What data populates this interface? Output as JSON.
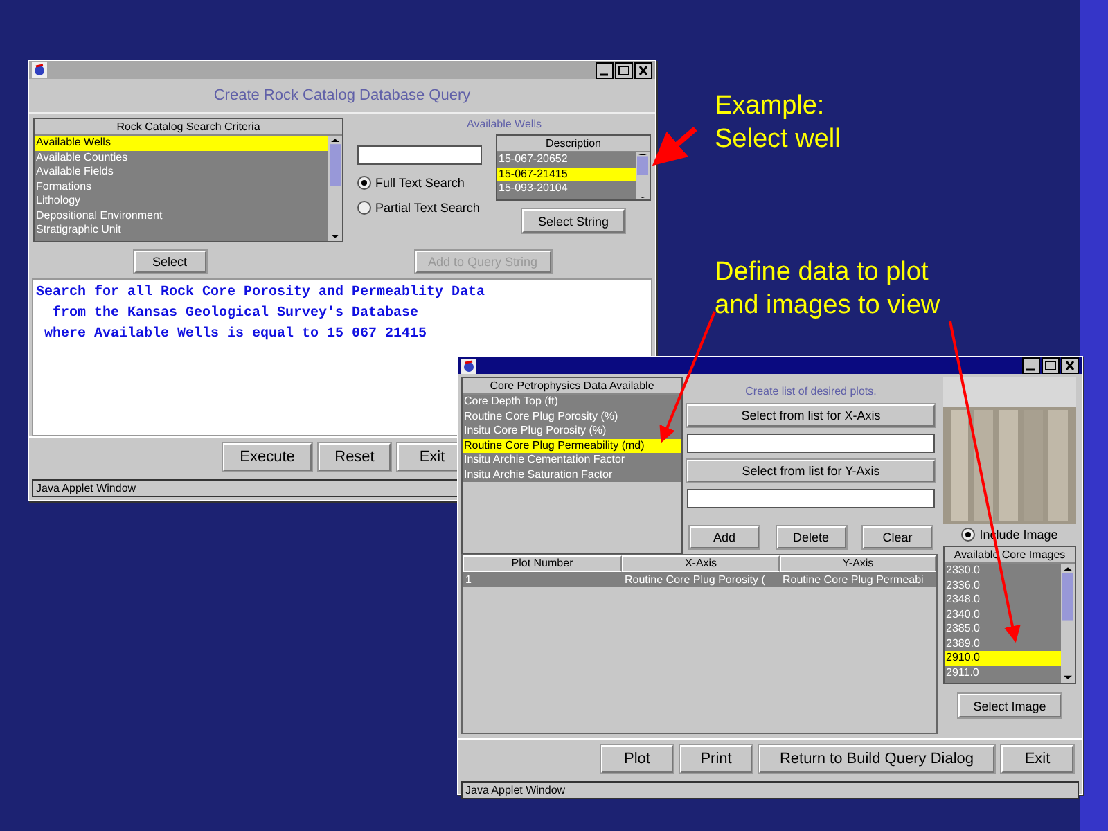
{
  "notes": [
    {
      "lines": [
        "Example:",
        "Select well"
      ]
    },
    {
      "lines": [
        "Define data to plot",
        "and images to view"
      ]
    }
  ],
  "query_window": {
    "heading": "Create Rock Catalog Database Query",
    "criteria": {
      "header": "Rock Catalog Search Criteria",
      "items": [
        {
          "label": "Available Wells",
          "selected": true
        },
        {
          "label": "Available Counties",
          "selected": false
        },
        {
          "label": "Available Fields",
          "selected": false
        },
        {
          "label": "Formations",
          "selected": false
        },
        {
          "label": "Lithology",
          "selected": false
        },
        {
          "label": "Depositional Environment",
          "selected": false
        },
        {
          "label": "Stratigraphic Unit",
          "selected": false
        }
      ]
    },
    "wells_label": "Available Wells",
    "search_modes": [
      {
        "label": "Full Text Search",
        "selected": true
      },
      {
        "label": "Partial Text Search",
        "selected": false
      }
    ],
    "wells": {
      "header": "Description",
      "items": [
        {
          "label": "15-067-20652",
          "selected": false
        },
        {
          "label": "15-067-21415",
          "selected": true
        },
        {
          "label": "15-093-20104",
          "selected": false
        }
      ]
    },
    "select_string_button": "Select String",
    "select_button": "Select",
    "add_button": {
      "label": "Add to Query String",
      "disabled": true
    },
    "query_text": [
      "Search for all Rock Core Porosity and Permeablity Data",
      "  from the Kansas Geological Survey's Database",
      " where Available Wells is equal to 15 067 21415"
    ],
    "buttons": [
      "Execute",
      "Reset",
      "Exit"
    ],
    "status_bar": "Java Applet Window"
  },
  "plot_window": {
    "data_list": {
      "header": "Core Petrophysics Data Available",
      "items": [
        {
          "label": "Core Depth Top (ft)",
          "selected": false
        },
        {
          "label": "Routine Core Plug Porosity (%)",
          "selected": false
        },
        {
          "label": "Insitu Core Plug Porosity (%)",
          "selected": false
        },
        {
          "label": "Routine Core Plug Permeability (md)",
          "selected": true
        },
        {
          "label": "Insitu Archie Cementation Factor",
          "selected": false
        },
        {
          "label": "Insitu Archie Saturation Factor",
          "selected": false
        }
      ]
    },
    "plots_label": "Create list of desired plots.",
    "x_axis_button": "Select from list for X-Axis",
    "y_axis_button": "Select from list for Y-Axis",
    "list_buttons": [
      "Add",
      "Delete",
      "Clear"
    ],
    "table": {
      "columns": [
        "Plot Number",
        "X-Axis",
        "Y-Axis"
      ],
      "rows": [
        [
          "1",
          "Routine Core Plug Porosity (",
          "Routine Core Plug Permeabi"
        ]
      ]
    },
    "include_image": {
      "label": "Include Image",
      "selected": true
    },
    "images": {
      "header": "Available Core Images",
      "items": [
        {
          "label": "2330.0",
          "selected": false
        },
        {
          "label": "2336.0",
          "selected": false
        },
        {
          "label": "2348.0",
          "selected": false
        },
        {
          "label": "2340.0",
          "selected": false
        },
        {
          "label": "2385.0",
          "selected": false
        },
        {
          "label": "2389.0",
          "selected": false
        },
        {
          "label": "2910.0",
          "selected": true
        },
        {
          "label": "2911.0",
          "selected": false
        }
      ]
    },
    "select_image_button": "Select Image",
    "buttons": [
      "Plot",
      "Print",
      "Return to Build Query Dialog",
      "Exit"
    ],
    "status_bar": "Java Applet Window"
  }
}
